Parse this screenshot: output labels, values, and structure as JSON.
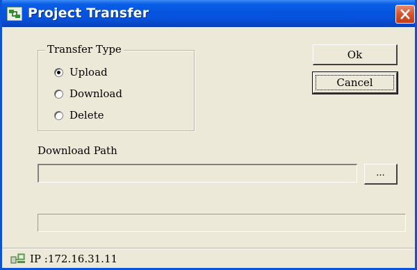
{
  "window": {
    "title": "Project Transfer"
  },
  "transfer_type": {
    "title": "Transfer Type",
    "options": [
      {
        "label": "Upload",
        "selected": true
      },
      {
        "label": "Download",
        "selected": false
      },
      {
        "label": "Delete",
        "selected": false
      }
    ]
  },
  "buttons": {
    "ok_label": "Ok",
    "cancel_label": "Cancel",
    "browse_label": "..."
  },
  "download_path": {
    "label": "Download Path",
    "value": ""
  },
  "progress": {
    "value": 0
  },
  "status": {
    "text": "IP :172.16.31.11"
  },
  "colors": {
    "titlebar": "#0554e0",
    "window_bg": "#ece9d8",
    "close_button": "#d6532d"
  },
  "icons": {
    "app": "app-icon",
    "close": "close-icon",
    "network": "network-icon"
  }
}
